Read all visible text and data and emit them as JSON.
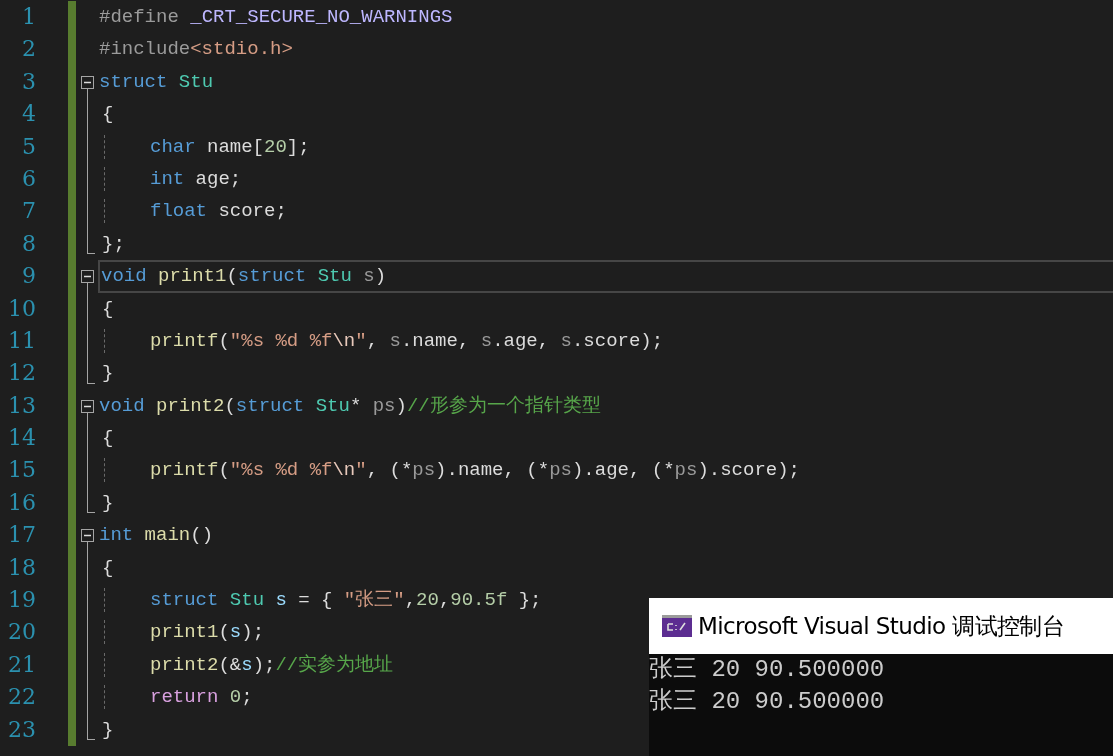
{
  "editor": {
    "lines": [
      {
        "number": "1",
        "kind": "plain",
        "fold": false,
        "current": false,
        "tokens": [
          {
            "kind": "pre",
            "text": "#define"
          },
          {
            "kind": "macro",
            "text": " _CRT_SECURE_NO_WARNINGS"
          }
        ]
      },
      {
        "number": "2",
        "kind": "plain",
        "fold": false,
        "current": false,
        "tokens": [
          {
            "kind": "pre",
            "text": "#include"
          },
          {
            "kind": "str",
            "text": "<stdio.h>"
          }
        ]
      },
      {
        "number": "3",
        "kind": "start",
        "fold": true,
        "current": false,
        "tokens": [
          {
            "kind": "kw",
            "text": "struct"
          },
          {
            "kind": "type",
            "text": " Stu"
          }
        ]
      },
      {
        "number": "4",
        "kind": "brace",
        "fold": false,
        "current": false,
        "tokens": [
          {
            "kind": "txt",
            "text": "{"
          }
        ]
      },
      {
        "number": "5",
        "kind": "body",
        "fold": false,
        "current": false,
        "tokens": [
          {
            "kind": "kw",
            "text": "char"
          },
          {
            "kind": "txt",
            "text": " name["
          },
          {
            "kind": "num",
            "text": "20"
          },
          {
            "kind": "txt",
            "text": "];"
          }
        ]
      },
      {
        "number": "6",
        "kind": "body",
        "fold": false,
        "current": false,
        "tokens": [
          {
            "kind": "kw",
            "text": "int"
          },
          {
            "kind": "txt",
            "text": " age;"
          }
        ]
      },
      {
        "number": "7",
        "kind": "body",
        "fold": false,
        "current": false,
        "tokens": [
          {
            "kind": "kw",
            "text": "float"
          },
          {
            "kind": "txt",
            "text": " score;"
          }
        ]
      },
      {
        "number": "8",
        "kind": "end",
        "fold": false,
        "current": false,
        "tokens": [
          {
            "kind": "txt",
            "text": "};"
          }
        ]
      },
      {
        "number": "9",
        "kind": "start",
        "fold": true,
        "current": true,
        "tokens": [
          {
            "kind": "kw",
            "text": "void"
          },
          {
            "kind": "fn",
            "text": " print1"
          },
          {
            "kind": "txt",
            "text": "("
          },
          {
            "kind": "kw",
            "text": "struct"
          },
          {
            "kind": "type",
            "text": " Stu"
          },
          {
            "kind": "param",
            "text": " s"
          },
          {
            "kind": "txt",
            "text": ")"
          }
        ]
      },
      {
        "number": "10",
        "kind": "brace",
        "fold": false,
        "current": false,
        "tokens": [
          {
            "kind": "txt",
            "text": "{"
          }
        ]
      },
      {
        "number": "11",
        "kind": "body",
        "fold": false,
        "current": false,
        "tokens": [
          {
            "kind": "fn",
            "text": "printf"
          },
          {
            "kind": "txt",
            "text": "("
          },
          {
            "kind": "str",
            "text": "\"%s %d %f"
          },
          {
            "kind": "esc",
            "text": "\\n"
          },
          {
            "kind": "str",
            "text": "\""
          },
          {
            "kind": "txt",
            "text": ", "
          },
          {
            "kind": "param",
            "text": "s"
          },
          {
            "kind": "txt",
            "text": ".name, "
          },
          {
            "kind": "param",
            "text": "s"
          },
          {
            "kind": "txt",
            "text": ".age, "
          },
          {
            "kind": "param",
            "text": "s"
          },
          {
            "kind": "txt",
            "text": ".score);"
          }
        ]
      },
      {
        "number": "12",
        "kind": "end",
        "fold": false,
        "current": false,
        "tokens": [
          {
            "kind": "txt",
            "text": "}"
          }
        ]
      },
      {
        "number": "13",
        "kind": "start",
        "fold": true,
        "current": false,
        "tokens": [
          {
            "kind": "kw",
            "text": "void"
          },
          {
            "kind": "fn",
            "text": " print2"
          },
          {
            "kind": "txt",
            "text": "("
          },
          {
            "kind": "kw",
            "text": "struct"
          },
          {
            "kind": "type",
            "text": " Stu"
          },
          {
            "kind": "txt",
            "text": "* "
          },
          {
            "kind": "param",
            "text": "ps"
          },
          {
            "kind": "txt",
            "text": ")"
          },
          {
            "kind": "cmt",
            "text": "//形参为一个指针类型"
          }
        ]
      },
      {
        "number": "14",
        "kind": "brace",
        "fold": false,
        "current": false,
        "tokens": [
          {
            "kind": "txt",
            "text": "{"
          }
        ]
      },
      {
        "number": "15",
        "kind": "body",
        "fold": false,
        "current": false,
        "tokens": [
          {
            "kind": "fn",
            "text": "printf"
          },
          {
            "kind": "txt",
            "text": "("
          },
          {
            "kind": "str",
            "text": "\"%s %d %f"
          },
          {
            "kind": "esc",
            "text": "\\n"
          },
          {
            "kind": "str",
            "text": "\""
          },
          {
            "kind": "txt",
            "text": ", (*"
          },
          {
            "kind": "param",
            "text": "ps"
          },
          {
            "kind": "txt",
            "text": ").name, (*"
          },
          {
            "kind": "param",
            "text": "ps"
          },
          {
            "kind": "txt",
            "text": ").age, (*"
          },
          {
            "kind": "param",
            "text": "ps"
          },
          {
            "kind": "txt",
            "text": ").score);"
          }
        ]
      },
      {
        "number": "16",
        "kind": "end",
        "fold": false,
        "current": false,
        "tokens": [
          {
            "kind": "txt",
            "text": "}"
          }
        ]
      },
      {
        "number": "17",
        "kind": "start",
        "fold": true,
        "current": false,
        "tokens": [
          {
            "kind": "kw",
            "text": "int"
          },
          {
            "kind": "fn",
            "text": " main"
          },
          {
            "kind": "txt",
            "text": "()"
          }
        ]
      },
      {
        "number": "18",
        "kind": "brace",
        "fold": false,
        "current": false,
        "tokens": [
          {
            "kind": "txt",
            "text": "{"
          }
        ]
      },
      {
        "number": "19",
        "kind": "body",
        "fold": false,
        "current": false,
        "tokens": [
          {
            "kind": "kw",
            "text": "struct"
          },
          {
            "kind": "type",
            "text": " Stu"
          },
          {
            "kind": "var",
            "text": " s"
          },
          {
            "kind": "txt",
            "text": " = { "
          },
          {
            "kind": "str",
            "text": "\"张三\""
          },
          {
            "kind": "txt",
            "text": ","
          },
          {
            "kind": "num",
            "text": "20"
          },
          {
            "kind": "txt",
            "text": ","
          },
          {
            "kind": "num",
            "text": "90.5f"
          },
          {
            "kind": "txt",
            "text": " };"
          }
        ]
      },
      {
        "number": "20",
        "kind": "body",
        "fold": false,
        "current": false,
        "tokens": [
          {
            "kind": "fn",
            "text": "print1"
          },
          {
            "kind": "txt",
            "text": "("
          },
          {
            "kind": "var",
            "text": "s"
          },
          {
            "kind": "txt",
            "text": ");"
          }
        ]
      },
      {
        "number": "21",
        "kind": "body",
        "fold": false,
        "current": false,
        "tokens": [
          {
            "kind": "fn",
            "text": "print2"
          },
          {
            "kind": "txt",
            "text": "(&"
          },
          {
            "kind": "var",
            "text": "s"
          },
          {
            "kind": "txt",
            "text": ");"
          },
          {
            "kind": "cmt",
            "text": "//实参为地址"
          }
        ]
      },
      {
        "number": "22",
        "kind": "body",
        "fold": false,
        "current": false,
        "tokens": [
          {
            "kind": "ctl",
            "text": "return"
          },
          {
            "kind": "num",
            "text": " 0"
          },
          {
            "kind": "txt",
            "text": ";"
          }
        ]
      },
      {
        "number": "23",
        "kind": "end",
        "fold": false,
        "current": false,
        "tokens": [
          {
            "kind": "txt",
            "text": "}"
          }
        ]
      }
    ]
  },
  "console": {
    "title": "Microsoft Visual Studio 调试控制台",
    "output": [
      "张三 20 90.500000",
      "张三 20 90.500000"
    ]
  }
}
